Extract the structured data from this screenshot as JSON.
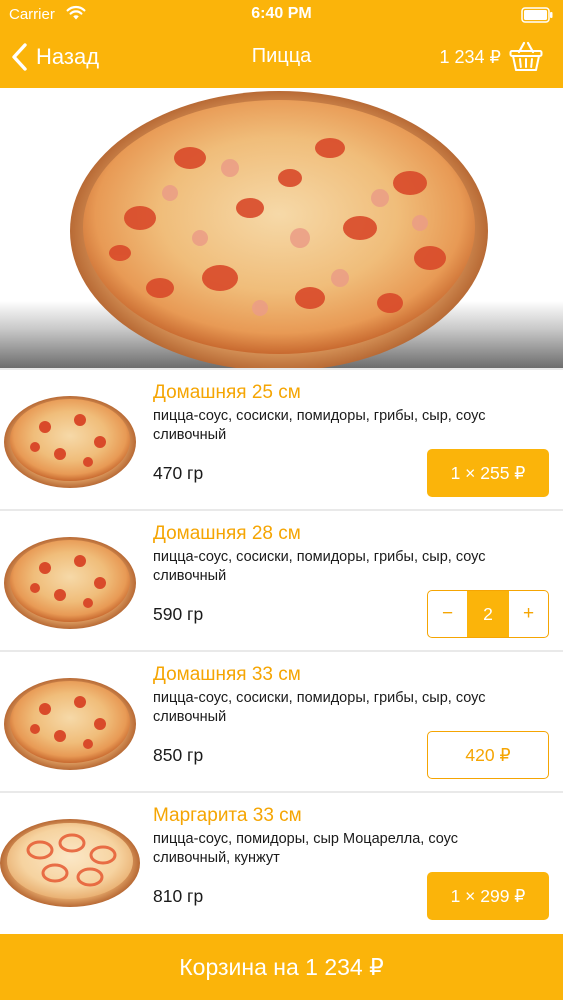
{
  "status_bar": {
    "carrier": "Carrier",
    "time": "6:40 PM"
  },
  "nav": {
    "back_label": "Назад",
    "title": "Пицца",
    "total": "1 234 ₽"
  },
  "products": [
    {
      "name": "Домашняя 25 см",
      "description": "пицца-соус, сосиски, помидоры, грибы, сыр, соус сливочный",
      "weight": "470 гр",
      "action": "1 × 255 ₽"
    },
    {
      "name": "Домашняя 28 см",
      "description": "пицца-соус, сосиски, помидоры, грибы, сыр, соус сливочный",
      "weight": "590 гр",
      "stepper": {
        "minus": "−",
        "count": "2",
        "plus": "+"
      }
    },
    {
      "name": "Домашняя 33 см",
      "description": "пицца-соус, сосиски, помидоры, грибы, сыр, соус сливочный",
      "weight": "850 гр",
      "action": "420 ₽"
    },
    {
      "name": "Маргарита 33 см",
      "description": "пицца-соус, помидоры, сыр Моцарелла, соус сливочный, кунжут",
      "weight": "810 гр",
      "action": "1 × 299 ₽"
    }
  ],
  "cart_button": {
    "label": "Корзина на 1 234 ₽"
  },
  "colors": {
    "accent": "#fbb40a",
    "accent_text": "#f5a503",
    "divider": "#e9e9e9"
  }
}
